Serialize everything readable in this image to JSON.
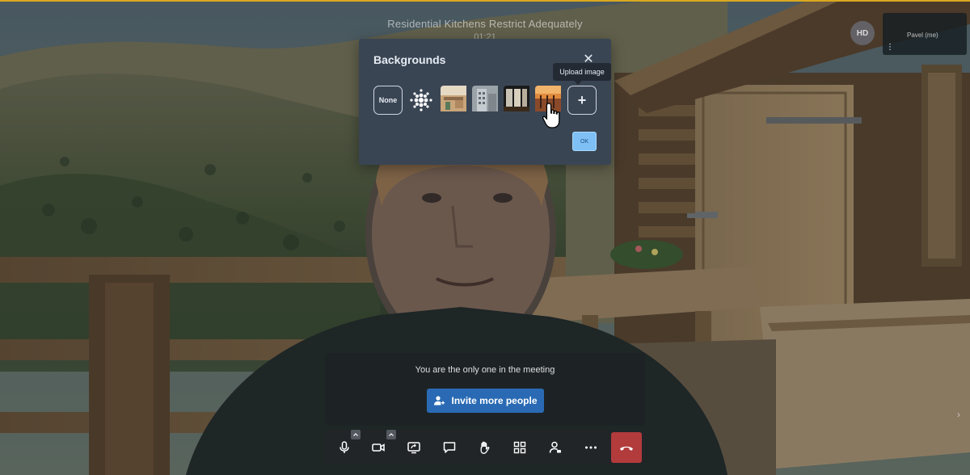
{
  "meeting": {
    "title": "Residential Kitchens Restrict Adequately",
    "timer": "01:21"
  },
  "participants": {
    "remote_avatar_initials": "HD",
    "self_label": "Pavel (me)",
    "self_menu_glyph": "⋮"
  },
  "backgrounds_dialog": {
    "title": "Backgrounds",
    "close_glyph": "✕",
    "options": [
      {
        "label": "None",
        "type": "none"
      },
      {
        "label": "",
        "type": "blur",
        "icon": "blur-dots-icon"
      },
      {
        "label": "",
        "type": "image",
        "icon": "office-image"
      },
      {
        "label": "",
        "type": "image",
        "icon": "building-image"
      },
      {
        "label": "",
        "type": "image",
        "icon": "window-image"
      },
      {
        "label": "",
        "type": "image",
        "icon": "sunset-image"
      }
    ],
    "add_glyph": "+",
    "tooltip": "Upload image",
    "ok_label": "OK"
  },
  "invite": {
    "message": "You are the only one in the meeting",
    "button_label": "Invite more people"
  },
  "toolbar": {
    "buttons": [
      "microphone-icon",
      "camera-icon",
      "screen-share-icon",
      "chat-icon",
      "raise-hand-icon",
      "tile-view-icon",
      "participants-icon",
      "more-options-icon",
      "hang-up-icon"
    ]
  },
  "colors": {
    "dialog_bg": "#3a4554",
    "ok_button": "#7ec0f5",
    "invite_button": "#2a6ab4",
    "hangup_button": "#b23b3b",
    "top_accent": "#d9a81f"
  }
}
